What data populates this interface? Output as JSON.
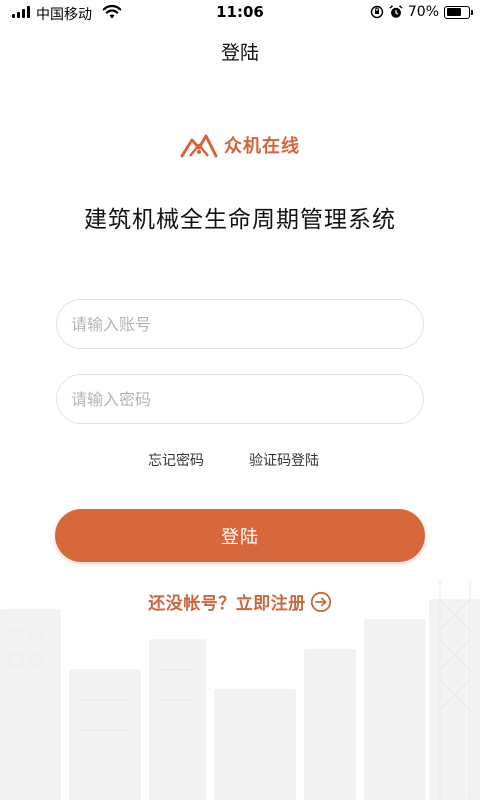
{
  "status_bar": {
    "carrier": "中国移动",
    "time": "11:06",
    "battery_text": "70%",
    "battery_level": 0.7
  },
  "nav": {
    "title": "登陆"
  },
  "brand": {
    "name": "众机在线",
    "accent_color": "#d4643b"
  },
  "system_title": "建筑机械全生命周期管理系统",
  "form": {
    "account_placeholder": "请输入账号",
    "password_placeholder": "请输入密码",
    "forgot_label": "忘记密码",
    "sms_login_label": "验证码登陆",
    "login_label": "登陆",
    "login_color": "#d7683c"
  },
  "register": {
    "label": "还没帐号？立即注册"
  },
  "icons": [
    "signal-icon",
    "wifi-icon",
    "orientation-lock-icon",
    "alarm-icon",
    "battery-icon",
    "brand-logo-icon",
    "arrow-right-circle-icon"
  ]
}
